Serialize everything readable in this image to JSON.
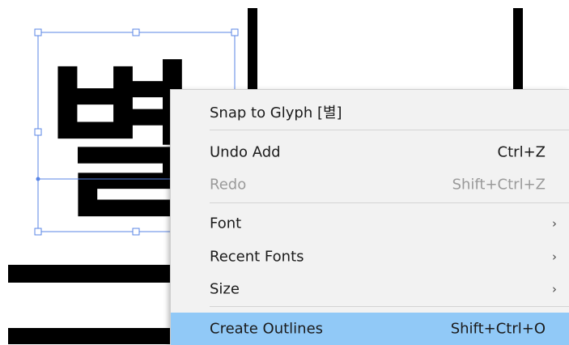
{
  "canvas": {
    "glyph_text": "별",
    "selection_color": "#5a86e6",
    "stroke_color": "#000000"
  },
  "context_menu": {
    "highlight_color": "#91c9f7",
    "items": [
      {
        "label": "Snap to Glyph [별]",
        "shortcut": "",
        "submenu": false,
        "enabled": true
      },
      {
        "label": "Undo Add",
        "shortcut": "Ctrl+Z",
        "submenu": false,
        "enabled": true
      },
      {
        "label": "Redo",
        "shortcut": "Shift+Ctrl+Z",
        "submenu": false,
        "enabled": false
      },
      {
        "label": "Font",
        "shortcut": "",
        "submenu": true,
        "enabled": true
      },
      {
        "label": "Recent Fonts",
        "shortcut": "",
        "submenu": true,
        "enabled": true
      },
      {
        "label": "Size",
        "shortcut": "",
        "submenu": true,
        "enabled": true
      },
      {
        "label": "Create Outlines",
        "shortcut": "Shift+Ctrl+O",
        "submenu": false,
        "enabled": true,
        "highlighted": true
      }
    ],
    "submenu_arrow": "›"
  }
}
